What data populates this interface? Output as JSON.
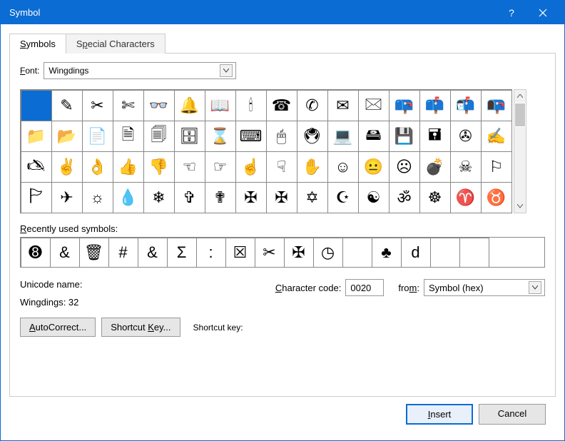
{
  "title": "Symbol",
  "titlebar": {
    "help": "?",
    "close": "×"
  },
  "tabs": {
    "symbols": "Symbols",
    "special": "Special Characters"
  },
  "font_label": "Font:",
  "font_value": "Wingdings",
  "recent_label": "Recently used symbols:",
  "unicode_name_label": "Unicode name:",
  "unicode_name_value": "Wingdings: 32",
  "charcode_label": "Character code:",
  "charcode_value": "0020",
  "from_label": "from:",
  "from_value": "Symbol (hex)",
  "autocorrect": "AutoCorrect...",
  "shortcut_key_btn": "Shortcut Key...",
  "shortcut_key_label": "Shortcut key:",
  "insert": "Insert",
  "cancel": "Cancel",
  "symbols": [
    {
      "name": "blank",
      "glyph": ""
    },
    {
      "name": "pencil",
      "glyph": "✎"
    },
    {
      "name": "scissors",
      "glyph": "✂"
    },
    {
      "name": "scissors-cut",
      "glyph": "✄"
    },
    {
      "name": "eyeglasses",
      "glyph": "👓"
    },
    {
      "name": "bell",
      "glyph": "🔔"
    },
    {
      "name": "open-book",
      "glyph": "📖"
    },
    {
      "name": "candle",
      "glyph": "🕯"
    },
    {
      "name": "telephone",
      "glyph": "☎"
    },
    {
      "name": "telephone-handset",
      "glyph": "✆"
    },
    {
      "name": "envelope",
      "glyph": "✉"
    },
    {
      "name": "envelope-stamped",
      "glyph": "🖂"
    },
    {
      "name": "mailbox-closed",
      "glyph": "📪"
    },
    {
      "name": "mailbox-flag",
      "glyph": "📫"
    },
    {
      "name": "mailbox-open",
      "glyph": "📬"
    },
    {
      "name": "mailbox-lowered",
      "glyph": "📭"
    },
    {
      "name": "folder",
      "glyph": "📁"
    },
    {
      "name": "folder-open",
      "glyph": "📂"
    },
    {
      "name": "document",
      "glyph": "📄"
    },
    {
      "name": "document-text",
      "glyph": "🗎"
    },
    {
      "name": "documents",
      "glyph": "🗐"
    },
    {
      "name": "file-cabinet",
      "glyph": "🗄"
    },
    {
      "name": "hourglass",
      "glyph": "⌛"
    },
    {
      "name": "keyboard",
      "glyph": "⌨"
    },
    {
      "name": "mouse",
      "glyph": "🖱"
    },
    {
      "name": "trackball",
      "glyph": "🖲"
    },
    {
      "name": "computer",
      "glyph": "💻"
    },
    {
      "name": "hard-disk",
      "glyph": "🖴"
    },
    {
      "name": "floppy-disk",
      "glyph": "💾"
    },
    {
      "name": "floppy-disk-black",
      "glyph": "🖬"
    },
    {
      "name": "tape",
      "glyph": "✇"
    },
    {
      "name": "writing-hand",
      "glyph": "✍"
    },
    {
      "name": "hand-left",
      "glyph": "🖎"
    },
    {
      "name": "victory-hand",
      "glyph": "✌"
    },
    {
      "name": "ok-hand",
      "glyph": "👌"
    },
    {
      "name": "thumbs-up",
      "glyph": "👍"
    },
    {
      "name": "thumbs-down",
      "glyph": "👎"
    },
    {
      "name": "point-left",
      "glyph": "☜"
    },
    {
      "name": "point-right",
      "glyph": "☞"
    },
    {
      "name": "point-up",
      "glyph": "☝"
    },
    {
      "name": "point-down",
      "glyph": "☟"
    },
    {
      "name": "raised-hand",
      "glyph": "✋"
    },
    {
      "name": "smiling-face",
      "glyph": "☺"
    },
    {
      "name": "neutral-face",
      "glyph": "😐"
    },
    {
      "name": "frowning-face",
      "glyph": "☹"
    },
    {
      "name": "bomb",
      "glyph": "💣"
    },
    {
      "name": "skull-crossbones",
      "glyph": "☠"
    },
    {
      "name": "flag",
      "glyph": "⚐"
    },
    {
      "name": "pennant",
      "glyph": "🏱"
    },
    {
      "name": "airplane",
      "glyph": "✈"
    },
    {
      "name": "sun",
      "glyph": "☼"
    },
    {
      "name": "droplet",
      "glyph": "💧"
    },
    {
      "name": "snowflake",
      "glyph": "❄"
    },
    {
      "name": "latin-cross",
      "glyph": "✞"
    },
    {
      "name": "shadowed-cross",
      "glyph": "✟"
    },
    {
      "name": "celtic-cross",
      "glyph": "✠"
    },
    {
      "name": "maltese-cross",
      "glyph": "✠"
    },
    {
      "name": "star-of-david",
      "glyph": "✡"
    },
    {
      "name": "star-crescent",
      "glyph": "☪"
    },
    {
      "name": "yin-yang",
      "glyph": "☯"
    },
    {
      "name": "om",
      "glyph": "ॐ"
    },
    {
      "name": "wheel-dharma",
      "glyph": "☸"
    },
    {
      "name": "aries",
      "glyph": "♈"
    },
    {
      "name": "taurus",
      "glyph": "♉"
    }
  ],
  "recent": [
    {
      "name": "eight-ball",
      "glyph": "➑"
    },
    {
      "name": "ampersand-script",
      "glyph": "&"
    },
    {
      "name": "trash",
      "glyph": "🗑"
    },
    {
      "name": "hash",
      "glyph": "#"
    },
    {
      "name": "ampersand",
      "glyph": "&"
    },
    {
      "name": "sigma",
      "glyph": "Σ"
    },
    {
      "name": "colon",
      "glyph": ":"
    },
    {
      "name": "ballot-x",
      "glyph": "☒"
    },
    {
      "name": "scissors-recent",
      "glyph": "✂"
    },
    {
      "name": "celtic-cross-recent",
      "glyph": "✠"
    },
    {
      "name": "clock",
      "glyph": "◷"
    },
    {
      "name": "blank-recent",
      "glyph": ""
    },
    {
      "name": "club",
      "glyph": "♣"
    },
    {
      "name": "letter-d",
      "glyph": "d"
    },
    {
      "name": "blank2",
      "glyph": ""
    },
    {
      "name": "blank3",
      "glyph": ""
    }
  ]
}
